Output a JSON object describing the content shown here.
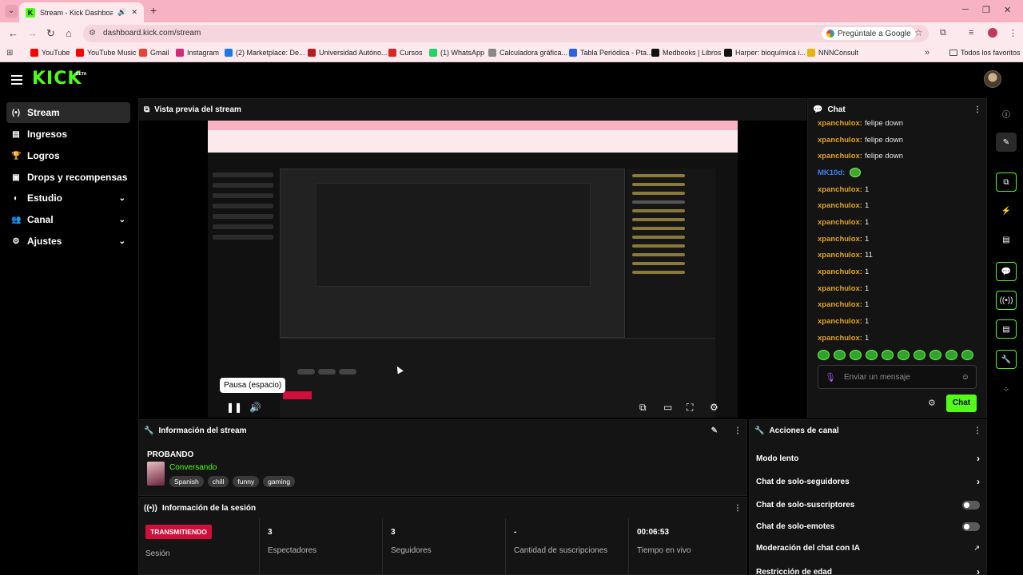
{
  "browser": {
    "tab_title": "Stream - Kick Dashboard",
    "url": "dashboard.kick.com/stream",
    "ask_google": "Pregúntale a Google",
    "bookmarks": [
      {
        "label": "YouTube",
        "color": "#ff0000"
      },
      {
        "label": "YouTube Music",
        "color": "#ff0000"
      },
      {
        "label": "Gmail",
        "color": "#ea4335"
      },
      {
        "label": "Instagram",
        "color": "#d62976"
      },
      {
        "label": "(2) Marketplace: De...",
        "color": "#1877f2"
      },
      {
        "label": "Universidad Autóno...",
        "color": "#b91c1c"
      },
      {
        "label": "Cursos",
        "color": "#dc2626"
      },
      {
        "label": "(1) WhatsApp",
        "color": "#25d366"
      },
      {
        "label": "Calculadora gráfica...",
        "color": "#888888"
      },
      {
        "label": "Tabla Periódica - Pta...",
        "color": "#2563eb"
      },
      {
        "label": "Medbooks | Libros",
        "color": "#111111"
      },
      {
        "label": "Harper: bioquímica i...",
        "color": "#111111"
      },
      {
        "label": "NNNConsult",
        "color": "#eab308"
      }
    ],
    "all_bookmarks": "Todos los favoritos"
  },
  "app": {
    "logo": "KICK",
    "beta": "BETA",
    "accent": "#53fc18"
  },
  "sidebar": {
    "items": [
      {
        "label": "Stream",
        "icon": "broadcast-icon",
        "active": true
      },
      {
        "label": "Ingresos",
        "icon": "money-icon"
      },
      {
        "label": "Logros",
        "icon": "trophy-icon"
      },
      {
        "label": "Drops y recompensas",
        "icon": "gift-icon"
      },
      {
        "label": "Estudio",
        "icon": "palette-icon",
        "expandable": true
      },
      {
        "label": "Canal",
        "icon": "users-icon",
        "expandable": true
      },
      {
        "label": "Ajustes",
        "icon": "gear-icon",
        "expandable": true
      }
    ]
  },
  "preview": {
    "title": "Vista previa del stream",
    "tooltip": "Pausa (espacio)"
  },
  "chat": {
    "title": "Chat",
    "messages": [
      {
        "user": "xpanchulox",
        "text": "felipe down"
      },
      {
        "user": "xpanchulox",
        "text": "felipe down"
      },
      {
        "user": "xpanchulox",
        "text": "felipe down"
      },
      {
        "user": "MK10d",
        "text": "",
        "emote": true
      },
      {
        "user": "xpanchulox",
        "text": "1"
      },
      {
        "user": "xpanchulox",
        "text": "1"
      },
      {
        "user": "xpanchulox",
        "text": "1"
      },
      {
        "user": "xpanchulox",
        "text": "1"
      },
      {
        "user": "xpanchulox",
        "text": "11"
      },
      {
        "user": "xpanchulox",
        "text": "1"
      },
      {
        "user": "xpanchulox",
        "text": "1"
      },
      {
        "user": "xpanchulox",
        "text": "1"
      },
      {
        "user": "xpanchulox",
        "text": "1"
      },
      {
        "user": "xpanchulox",
        "text": "1"
      }
    ],
    "placeholder": "Enviar un mensaje",
    "send_label": "Chat"
  },
  "stream_info": {
    "title": "Información del stream",
    "stream_title": "PROBANDO",
    "category": "Conversando",
    "tags": [
      "Spanish",
      "chill",
      "funny",
      "gaming"
    ]
  },
  "session": {
    "title": "Información de la sesión",
    "status_badge": "TRANSMITIENDO",
    "status_label": "Sesión",
    "viewers": {
      "value": "3",
      "label": "Espectadores"
    },
    "followers": {
      "value": "3",
      "label": "Seguidores"
    },
    "subs": {
      "value": "-",
      "label": "Cantidad de suscripciones"
    },
    "uptime": {
      "value": "00:06:53",
      "label": "Tiempo en vivo"
    }
  },
  "channel_actions": {
    "title": "Acciones de canal",
    "rows": [
      {
        "label": "Modo lento",
        "control": "chevron"
      },
      {
        "label": "Chat de solo-seguidores",
        "control": "chevron"
      },
      {
        "label": "Chat de solo-suscriptores",
        "control": "toggle"
      },
      {
        "label": "Chat de solo-emotes",
        "control": "toggle"
      },
      {
        "label": "Moderación del chat con IA",
        "control": "external"
      },
      {
        "label": "Restricción de edad",
        "control": "chevron"
      }
    ]
  }
}
